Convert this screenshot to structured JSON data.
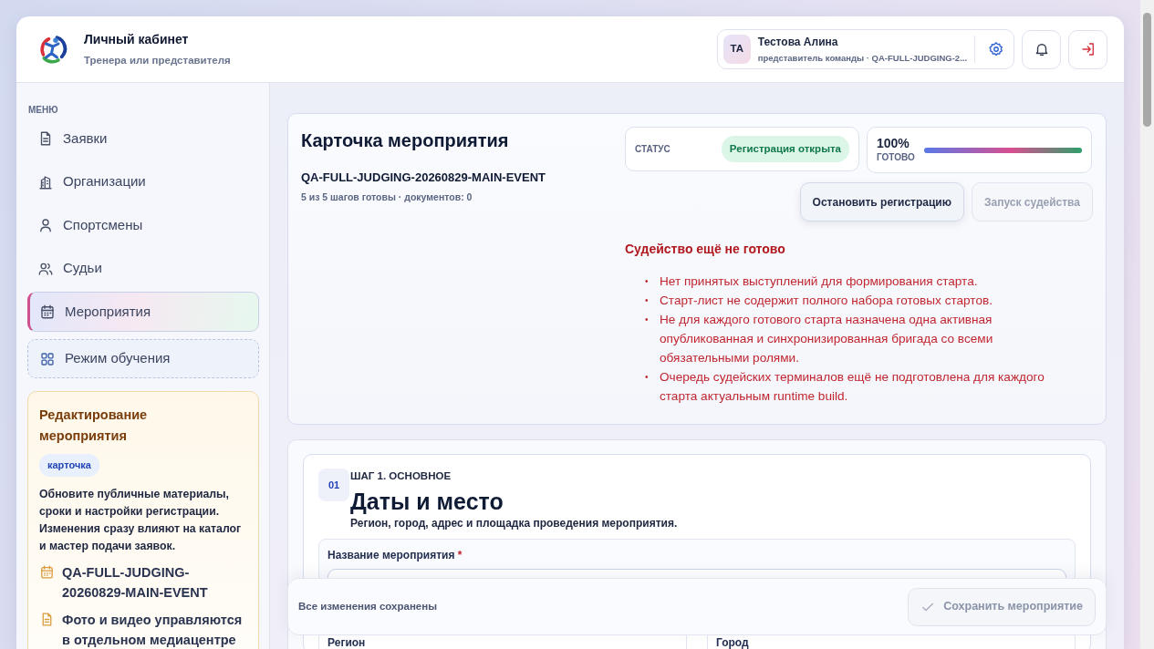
{
  "header": {
    "title": "Личный кабинет",
    "subtitle": "Тренера или представителя",
    "user": {
      "initials": "ТА",
      "name": "Тестова Алина",
      "role": "представитель команды · QA-FULL-JUDGING-2..."
    }
  },
  "sidebar": {
    "menu_label": "МЕНЮ",
    "items": [
      {
        "label": "Заявки",
        "kind": "document",
        "selected": false
      },
      {
        "label": "Организации",
        "kind": "building",
        "selected": false
      },
      {
        "label": "Спортсмены",
        "kind": "person",
        "selected": false
      },
      {
        "label": "Судьи",
        "kind": "people",
        "selected": false
      },
      {
        "label": "Мероприятия",
        "kind": "calendar",
        "selected": true
      }
    ],
    "training": {
      "label": "Режим обучения"
    },
    "edit_card": {
      "title": "Редактирование мероприятия",
      "tag": "карточка",
      "text": "Обновите публичные материалы, сроки и настройки регистрации. Изменения сразу влияют на каталог и мастер подачи заявок.",
      "facts": [
        {
          "kind": "calendar",
          "text": "QA-FULL-JUDGING-20260829-MAIN-EVENT"
        },
        {
          "kind": "document",
          "text": "Фото и видео управляются в отдельном медиацентре"
        }
      ]
    }
  },
  "event_card": {
    "title": "Карточка мероприятия",
    "code": "QA-FULL-JUDGING-20260829-MAIN-EVENT",
    "progress_text": "5 из 5 шагов готовы · документов: 0",
    "status": {
      "label": "СТАТУС",
      "value": "Регистрация открыта"
    },
    "readiness": {
      "percent": "100%",
      "label": "ГОТОВО",
      "level": 1
    },
    "buttons": [
      {
        "label": "Остановить регистрацию",
        "disabled": false
      },
      {
        "label": "Запуск судейства",
        "disabled": true
      }
    ],
    "warning": {
      "title": "Судейство ещё не готово",
      "items": [
        {
          "marker": "•",
          "text": "Нет принятых выступлений для формирования старта."
        },
        {
          "marker": "•",
          "text": "Старт-лист не содержит полного набора готовых стартов."
        },
        {
          "marker": "•",
          "text": "Не для каждого готового старта назначена одна активная опубликованная и синхронизированная бригада со всеми обязательными ролями."
        },
        {
          "marker": "•",
          "text": "Очередь судейских терминалов ещё не подготовлена для каждого старта актуальным runtime build."
        }
      ]
    }
  },
  "step": {
    "number": "01",
    "kicker": "ШАГ 1. ОСНОВНОЕ",
    "title": "Даты и место",
    "description": "Регион, город, адрес и площадка проведения мероприятия.",
    "name_field": {
      "label": "Название мероприятия",
      "required_mark": "*"
    },
    "fields": [
      {
        "label": "Регион"
      },
      {
        "label": "Город"
      }
    ]
  },
  "save_bar": {
    "status": "Все изменения сохранены",
    "button": {
      "label": "Сохранить мероприятие",
      "disabled": true
    }
  }
}
